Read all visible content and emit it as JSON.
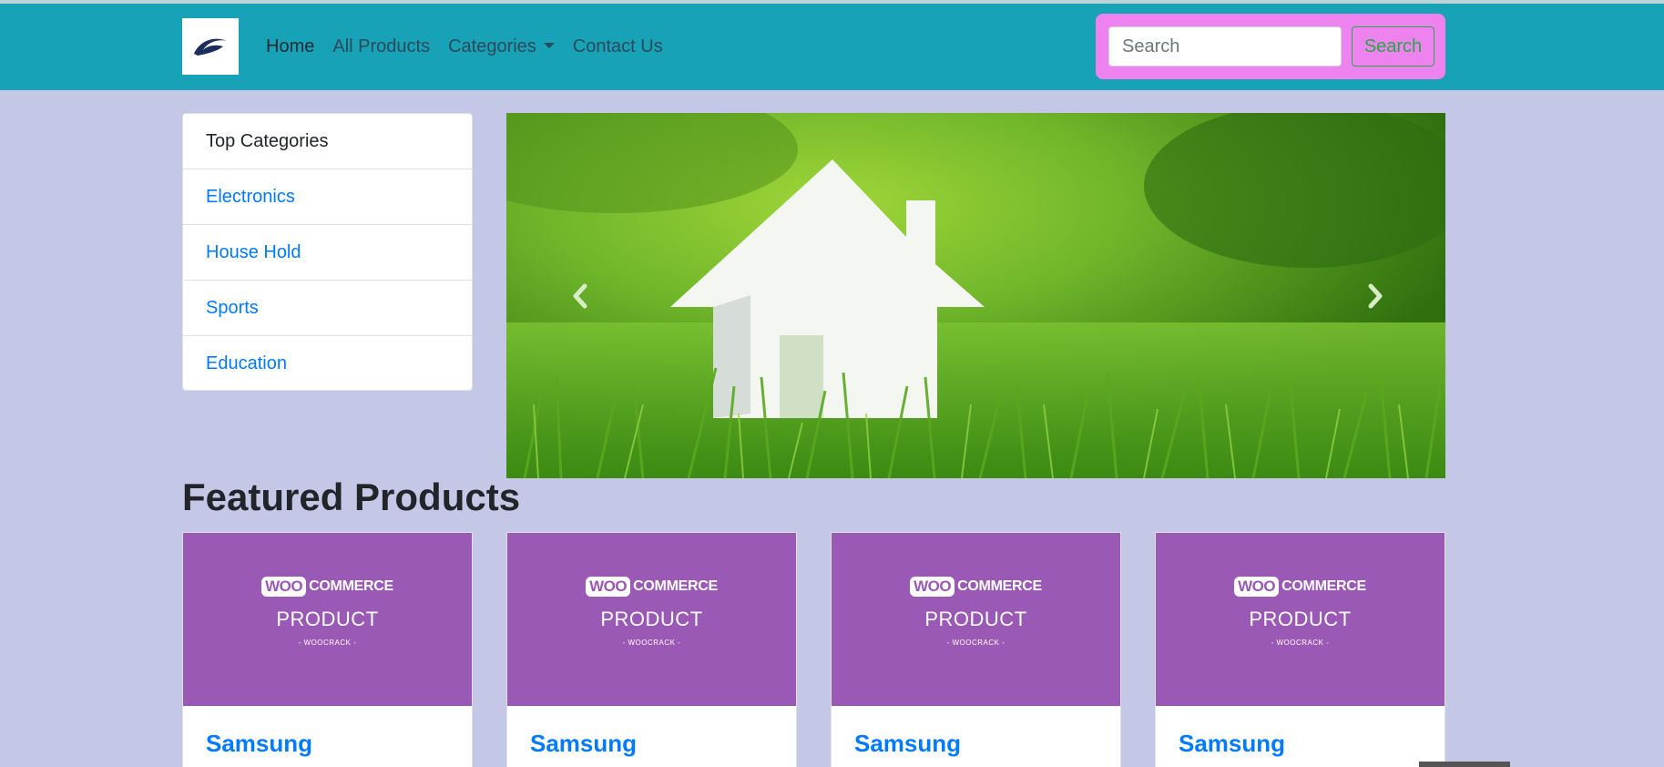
{
  "navbar": {
    "links": [
      "Home",
      "All Products",
      "Categories",
      "Contact Us"
    ],
    "search_placeholder": "Search",
    "search_button": "Search"
  },
  "categories": {
    "header": "Top Categories",
    "items": [
      "Electronics",
      "House Hold",
      "Sports",
      "Education"
    ]
  },
  "carousel": {
    "prev_icon": "chevron-left-icon",
    "next_icon": "chevron-right-icon"
  },
  "featured": {
    "title": "Featured Products",
    "products": [
      {
        "image_brand_woo": "WOO",
        "image_brand_commerce": "COMMERCE",
        "image_label": "PRODUCT",
        "image_sub": "- WOOCRACK -",
        "name": "Samsung"
      },
      {
        "image_brand_woo": "WOO",
        "image_brand_commerce": "COMMERCE",
        "image_label": "PRODUCT",
        "image_sub": "- WOOCRACK -",
        "name": "Samsung"
      },
      {
        "image_brand_woo": "WOO",
        "image_brand_commerce": "COMMERCE",
        "image_label": "PRODUCT",
        "image_sub": "- WOOCRACK -",
        "name": "Samsung"
      },
      {
        "image_brand_woo": "WOO",
        "image_brand_commerce": "COMMERCE",
        "image_label": "PRODUCT",
        "image_sub": "- WOOCRACK -",
        "name": "Samsung"
      }
    ]
  },
  "colors": {
    "navbar_bg": "#17a2b8",
    "page_bg": "#c5c7e6",
    "search_wrap_bg": "#ee82ee",
    "link_blue": "#007bff",
    "product_purple": "#9b59b6"
  }
}
